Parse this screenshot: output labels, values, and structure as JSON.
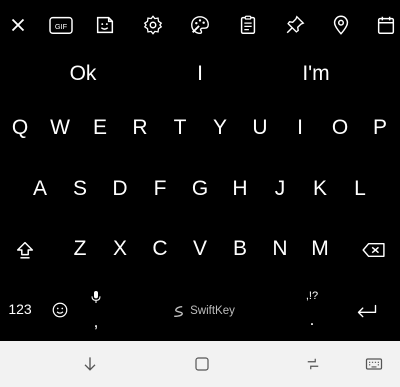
{
  "toolbar": {
    "icons": [
      "close-icon",
      "gif-icon",
      "sticker-icon",
      "settings-icon",
      "theme-icon",
      "clipboard-icon",
      "pin-icon",
      "location-icon",
      "calendar-icon"
    ],
    "gif_label": "GIF"
  },
  "suggestions": [
    "Ok",
    "I",
    "I'm"
  ],
  "keyboard": {
    "row1": [
      "Q",
      "W",
      "E",
      "R",
      "T",
      "Y",
      "U",
      "I",
      "O",
      "P"
    ],
    "row2": [
      "A",
      "S",
      "D",
      "F",
      "G",
      "H",
      "J",
      "K",
      "L"
    ],
    "row3": [
      "Z",
      "X",
      "C",
      "V",
      "B",
      "N",
      "M"
    ],
    "numbers_label": "123",
    "comma_label": ",",
    "brand_label": "SwiftKey",
    "punct_hint": ",!?",
    "period_label": "."
  },
  "colors": {
    "background": "#000000",
    "key_text": "#ffffff",
    "navbar": "#f2f2f2",
    "nav_icon": "#555555"
  }
}
